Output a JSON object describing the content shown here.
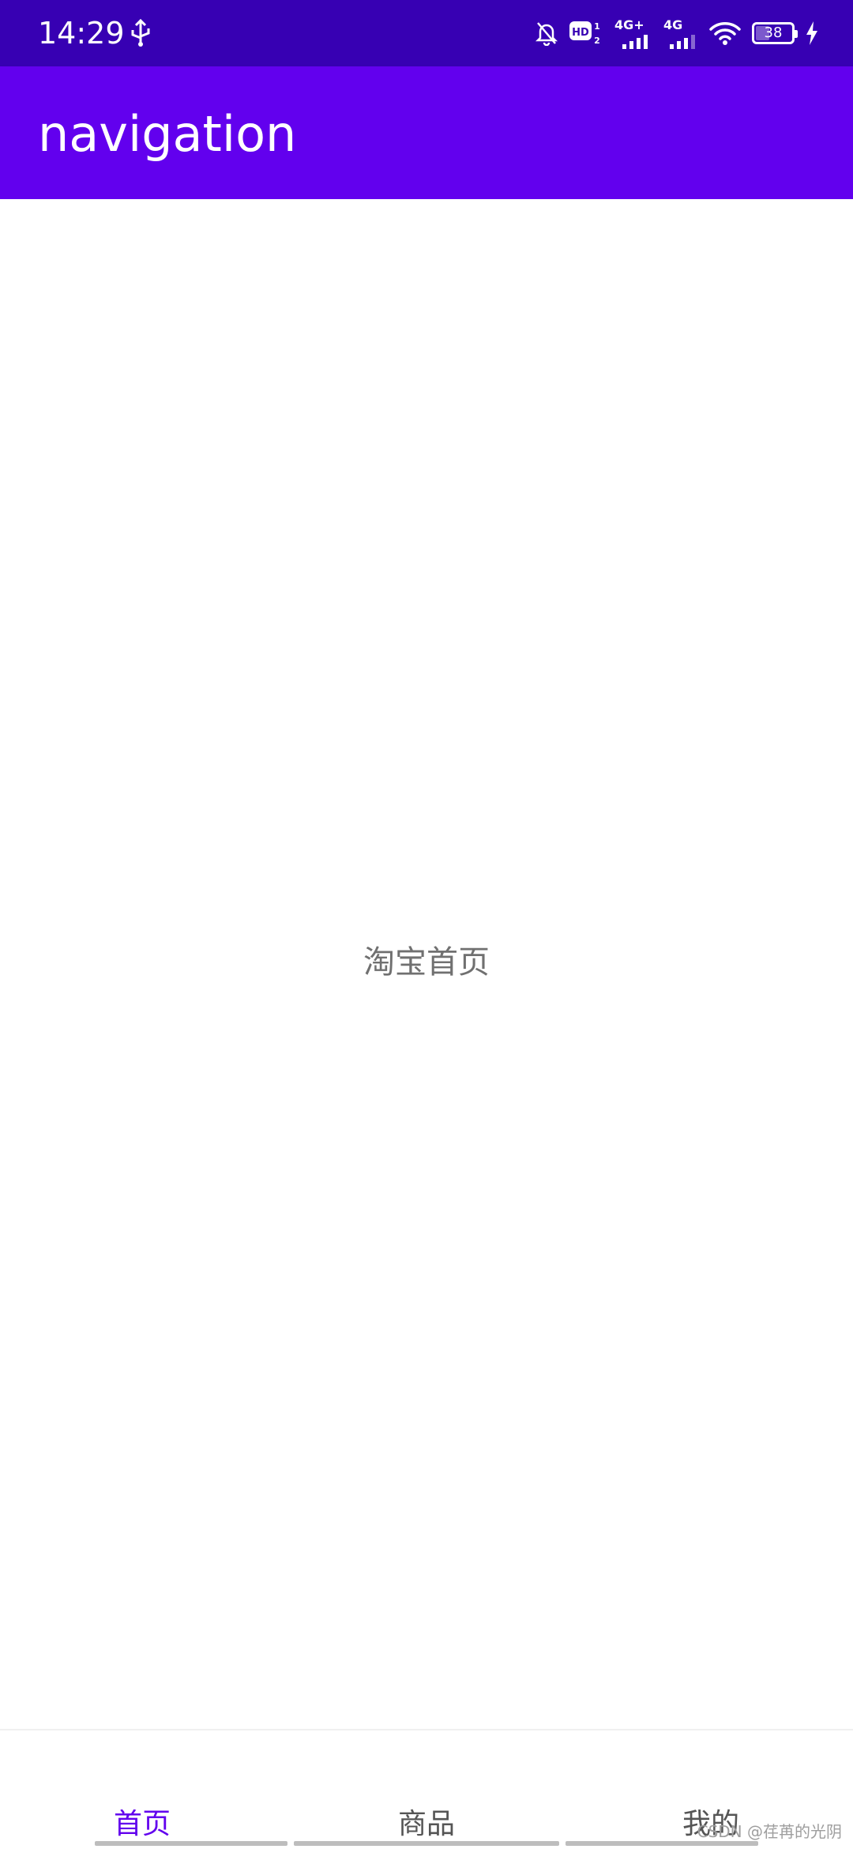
{
  "status_bar": {
    "time": "14:29",
    "network_1": "4G+",
    "network_2": "4G",
    "battery_level": "38",
    "icons": [
      "usb-icon",
      "bell-off-icon",
      "hd-icon",
      "signal-icon",
      "wifi-icon",
      "battery-icon",
      "charging-icon"
    ]
  },
  "app_bar": {
    "title": "navigation"
  },
  "main": {
    "text": "淘宝首页"
  },
  "bottom_nav": {
    "items": [
      {
        "label": "首页",
        "active": true
      },
      {
        "label": "商品",
        "active": false
      },
      {
        "label": "我的",
        "active": false
      }
    ]
  },
  "watermark": "CSDN @荏苒的光阴",
  "colors": {
    "status_bar": "#3700b3",
    "app_bar": "#6200ee",
    "accent": "#6200ee",
    "inactive": "#555555"
  }
}
